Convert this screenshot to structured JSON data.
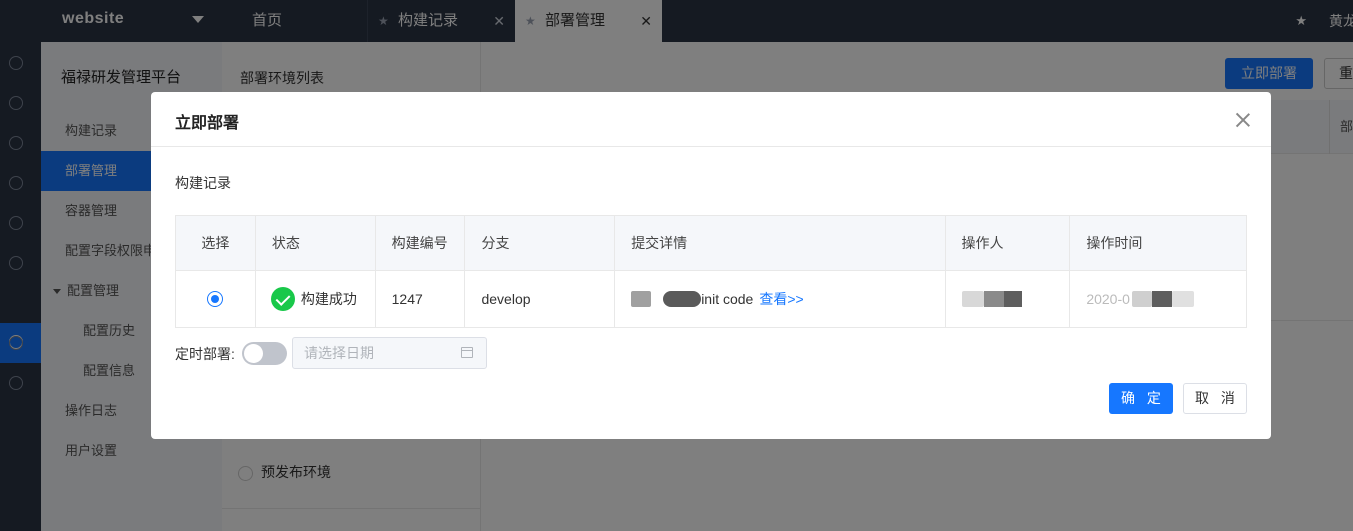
{
  "app": {
    "brand": "website",
    "tabs": [
      {
        "label": "首页"
      },
      {
        "label": "构建记录"
      },
      {
        "label": "部署管理"
      }
    ],
    "user_name": "黄龙"
  },
  "sidebar": {
    "title": "福禄研发管理平台",
    "items": [
      {
        "label": "构建记录"
      },
      {
        "label": "部署管理"
      },
      {
        "label": "容器管理"
      },
      {
        "label": "配置字段权限申请"
      },
      {
        "label": "配置管理"
      },
      {
        "label": "配置历史"
      },
      {
        "label": "配置信息"
      },
      {
        "label": "操作日志"
      },
      {
        "label": "用户设置"
      }
    ]
  },
  "env_panel": {
    "title": "部署环境列表",
    "radio_label": "预发布环境"
  },
  "content": {
    "deploy_button": "立即部署",
    "reset_button": "重置",
    "column_partial": "部"
  },
  "modal": {
    "title": "立即部署",
    "section_label": "构建记录",
    "columns": [
      "选择",
      "状态",
      "构建编号",
      "分支",
      "提交详情",
      "操作人",
      "操作时间"
    ],
    "row": {
      "selected": true,
      "status": "构建成功",
      "build_no": "1247",
      "branch": "develop",
      "commit_text": "init code",
      "commit_link": "查看>>",
      "time_partial": "2020-0"
    },
    "schedule_label": "定时部署:",
    "schedule_enabled": false,
    "date_placeholder": "请选择日期",
    "confirm": "确 定",
    "cancel": "取 消"
  },
  "colors": {
    "accent": "#1677ff",
    "topbar": "#2b3445",
    "success": "#19c84a"
  }
}
